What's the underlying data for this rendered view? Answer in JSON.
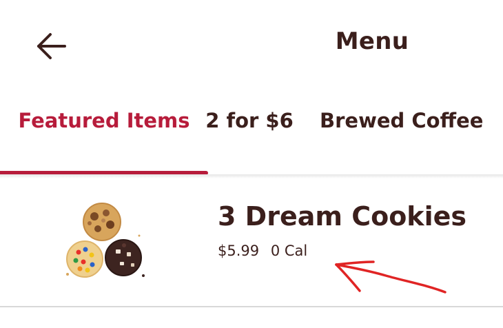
{
  "header": {
    "title": "Menu",
    "back_icon": "arrow-left-icon"
  },
  "tabs": [
    {
      "label": "Featured Items",
      "active": true
    },
    {
      "label": "2 for $6",
      "active": false
    },
    {
      "label": "Brewed Coffee",
      "active": false
    }
  ],
  "items": [
    {
      "name": "3 Dream Cookies",
      "price": "$5.99",
      "calories": "0 Cal",
      "image_icon": "cookies-image"
    }
  ],
  "colors": {
    "accent": "#b71c3b",
    "text": "#3b1f1c",
    "annotation": "#e02424"
  }
}
